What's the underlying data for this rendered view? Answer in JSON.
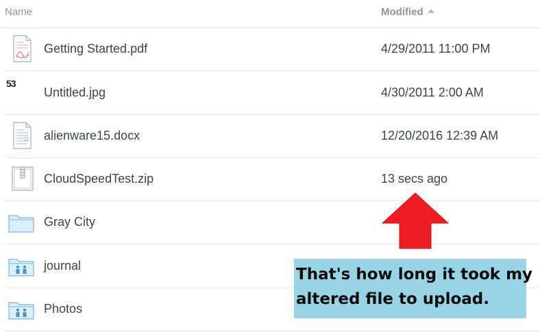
{
  "header": {
    "name_label": "Name",
    "modified_label": "Modified"
  },
  "files": [
    {
      "name": "Getting Started.pdf",
      "modified": "4/29/2011 11:00 PM",
      "icon": "pdf-file-icon"
    },
    {
      "name": "Untitled.jpg",
      "modified": "4/30/2011 2:00 AM",
      "icon": "image-thumbnail-icon",
      "thumb_text": "53"
    },
    {
      "name": "alienware15.docx",
      "modified": "12/20/2016 12:39 AM",
      "icon": "document-file-icon"
    },
    {
      "name": "CloudSpeedTest.zip",
      "modified": "13 secs ago",
      "icon": "zip-file-icon"
    },
    {
      "name": "Gray City",
      "modified": "",
      "icon": "folder-icon"
    },
    {
      "name": "journal",
      "modified": "",
      "icon": "shared-folder-icon"
    },
    {
      "name": "Photos",
      "modified": "",
      "icon": "shared-folder-icon"
    }
  ],
  "annotation": {
    "line1": "That's how long it took my",
    "line2": "altered file to upload.",
    "arrow_color": "#ee1c25",
    "box_color": "#99d3e6"
  }
}
